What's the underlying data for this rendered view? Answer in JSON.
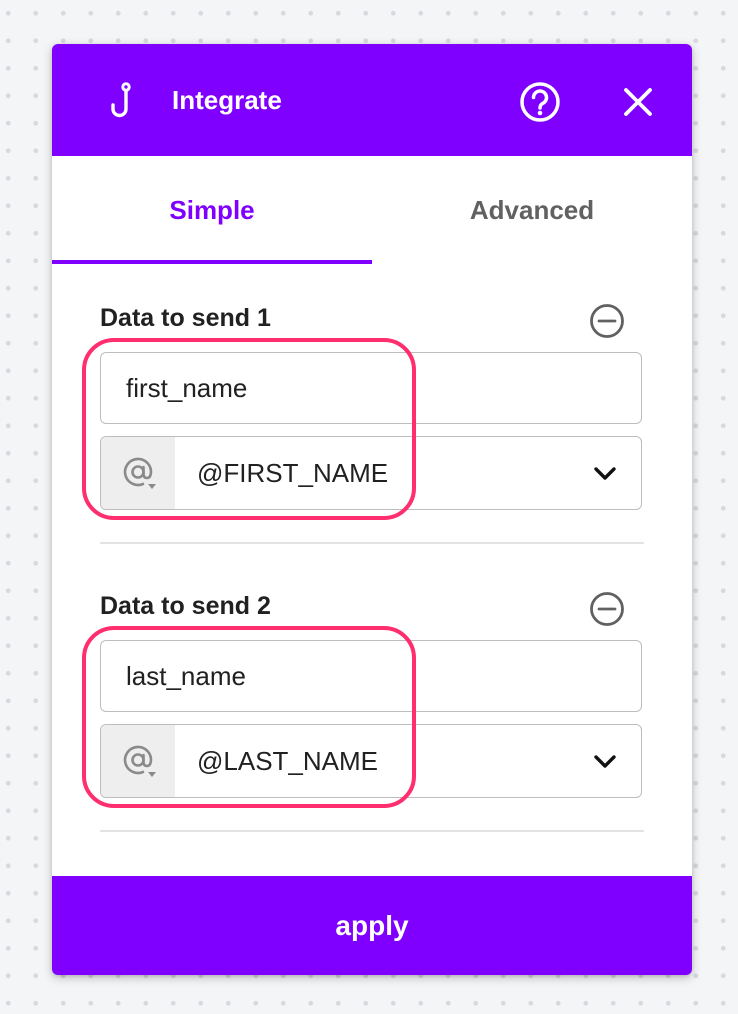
{
  "header": {
    "title": "Integrate",
    "icons": {
      "logo": "hook-icon",
      "help": "help-circle-icon",
      "close": "close-icon"
    }
  },
  "tabs": [
    {
      "label": "Simple",
      "active": true
    },
    {
      "label": "Advanced",
      "active": false
    }
  ],
  "data_items": [
    {
      "label": "Data to send 1",
      "key_value": "first_name",
      "variable_prefix_icon": "at-sign-icon",
      "variable_value": "@FIRST_NAME"
    },
    {
      "label": "Data to send 2",
      "key_value": "last_name",
      "variable_prefix_icon": "at-sign-icon",
      "variable_value": "@LAST_NAME"
    }
  ],
  "footer": {
    "apply_label": "apply"
  },
  "colors": {
    "accent": "#7f00ff",
    "highlight": "#ff2e6e",
    "canvas": "#f4f5f7"
  }
}
